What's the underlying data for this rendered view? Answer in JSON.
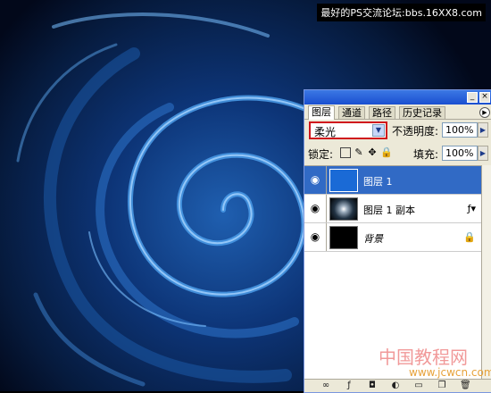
{
  "watermark_top": "最好的PS交流论坛:bbs.16XX8.com",
  "panel": {
    "tabs": [
      {
        "label": "图层",
        "active": true
      },
      {
        "label": "通道",
        "active": false
      },
      {
        "label": "路径",
        "active": false
      },
      {
        "label": "历史记录",
        "active": false
      }
    ],
    "blend_mode": "柔光",
    "opacity_label": "不透明度:",
    "opacity_value": "100%",
    "lock_label": "锁定:",
    "fill_label": "填充:",
    "fill_value": "100%",
    "layers": [
      {
        "name": "图层 1",
        "selected": true,
        "thumb": "blue"
      },
      {
        "name": "图层 1 副本",
        "selected": false,
        "thumb": "swirl"
      },
      {
        "name": "背景",
        "selected": false,
        "thumb": "black",
        "locked": true
      }
    ]
  },
  "watermark_bottom": {
    "cn": "中国教程网",
    "url": "www.jcwcn.com"
  },
  "colors": {
    "selection": "#316ac5",
    "blend_highlight": "#d0161c",
    "layer1_fill": "#1a6ad6"
  }
}
